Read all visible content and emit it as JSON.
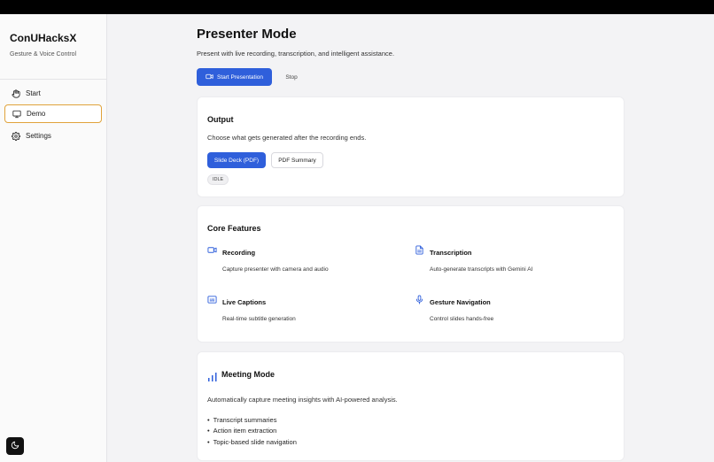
{
  "app": {
    "brand": "ConUHacksX",
    "tagline": "Gesture & Voice Control"
  },
  "sidebar": {
    "items": [
      {
        "label": "Start",
        "icon": "hand-icon"
      },
      {
        "label": "Demo",
        "icon": "monitor-icon",
        "active": true
      },
      {
        "label": "Settings",
        "icon": "gear-icon"
      }
    ]
  },
  "header": {
    "title": "Presenter Mode",
    "subtitle": "Present with live recording, transcription, and intelligent assistance.",
    "start_label": "Start Presentation",
    "stop_label": "Stop"
  },
  "output": {
    "title": "Output",
    "description": "Choose what gets generated after the recording ends.",
    "options": [
      "Slide Deck (PDF)",
      "PDF Summary"
    ],
    "selected": "Slide Deck (PDF)",
    "status": "IDLE"
  },
  "features": {
    "title": "Core Features",
    "items": [
      {
        "title": "Recording",
        "desc": "Capture presenter with camera and audio",
        "icon": "video-icon"
      },
      {
        "title": "Transcription",
        "desc": "Auto-generate transcripts with Gemini AI",
        "icon": "document-icon"
      },
      {
        "title": "Live Captions",
        "desc": "Real-time subtitle generation",
        "icon": "captions-icon"
      },
      {
        "title": "Gesture Navigation",
        "desc": "Control slides hands-free",
        "icon": "microphone-icon"
      }
    ]
  },
  "meeting": {
    "title": "Meeting Mode",
    "description": "Automatically capture meeting insights with AI-powered analysis.",
    "bullets": [
      "Transcript summaries",
      "Action item extraction",
      "Topic-based slide navigation"
    ]
  },
  "colors": {
    "accent": "#2f5fdb",
    "active_border": "#e0a33b"
  }
}
